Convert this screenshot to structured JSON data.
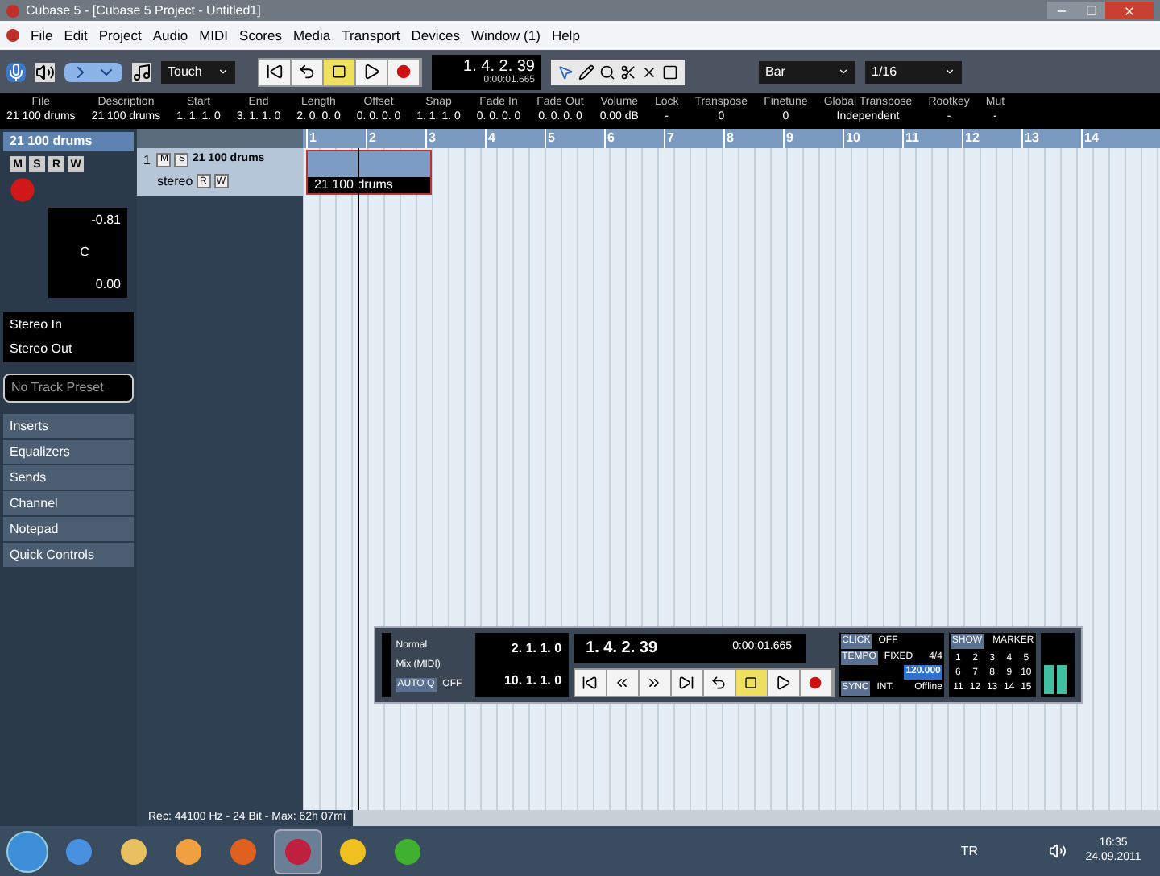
{
  "window": {
    "title": "Cubase 5 - [Cubase 5 Project - Untitled1]"
  },
  "menu": [
    "File",
    "Edit",
    "Project",
    "Audio",
    "MIDI",
    "Scores",
    "Media",
    "Transport",
    "Devices",
    "Window (1)",
    "Help"
  ],
  "toolbar": {
    "automation_mode": "Touch",
    "transport": [
      {
        "kind": "start",
        "active": false
      },
      {
        "kind": "cycle",
        "active": false
      },
      {
        "kind": "stop",
        "active": true
      },
      {
        "kind": "play",
        "active": false
      },
      {
        "kind": "record",
        "active": false
      }
    ],
    "position": "1. 4. 2. 39",
    "time": "0:00:01.665",
    "grid": "Bar",
    "quantize": "1/16"
  },
  "info_line": [
    {
      "label": "File",
      "value": "21 100 drums"
    },
    {
      "label": "Description",
      "value": "21 100 drums"
    },
    {
      "label": "Start",
      "value": "1. 1. 1. 0"
    },
    {
      "label": "End",
      "value": "3. 1. 1. 0"
    },
    {
      "label": "Length",
      "value": "2. 0. 0. 0"
    },
    {
      "label": "Offset",
      "value": "0. 0. 0. 0"
    },
    {
      "label": "Snap",
      "value": "1. 1. 1. 0"
    },
    {
      "label": "Fade In",
      "value": "0. 0. 0. 0"
    },
    {
      "label": "Fade Out",
      "value": "0. 0. 0. 0"
    },
    {
      "label": "Volume",
      "value": "0.00 dB"
    },
    {
      "label": "Lock",
      "value": "-"
    },
    {
      "label": "Transpose",
      "value": "0"
    },
    {
      "label": "Finetune",
      "value": "0"
    },
    {
      "label": "Global Transpose",
      "value": "Independent"
    },
    {
      "label": "Rootkey",
      "value": "-"
    },
    {
      "label": "Mut",
      "value": "-"
    }
  ],
  "inspector": {
    "track_name": "21 100 drums",
    "buttons": [
      "M",
      "S",
      "R",
      "W"
    ],
    "volume": "-0.81",
    "pan": "C",
    "delay": "0.00",
    "input": "Stereo In",
    "output": "Stereo Out",
    "preset": "No Track Preset",
    "sections": [
      "Inserts",
      "Equalizers",
      "Sends",
      "Channel",
      "Notepad",
      "Quick Controls"
    ]
  },
  "track": {
    "number": "1",
    "name": "21 100 drums",
    "channel": "stereo",
    "buttons": [
      "M",
      "S",
      "R",
      "W"
    ],
    "event": "21 100 drums"
  },
  "ruler": [
    "1",
    "2",
    "3",
    "4",
    "5",
    "6",
    "7",
    "8",
    "9",
    "10",
    "11",
    "12",
    "13",
    "14"
  ],
  "transport": {
    "mode": "Normal",
    "mix": "Mix (MIDI)",
    "auto_q": "AUTO Q",
    "auto_q_state": "OFF",
    "left_locator": "2. 1. 1. 0",
    "right_locator": "10. 1. 1. 0",
    "position": "1. 4. 2. 39",
    "time": "0:00:01.665",
    "buttons": [
      {
        "kind": "start",
        "active": false
      },
      {
        "kind": "rewind",
        "active": false
      },
      {
        "kind": "forward",
        "active": false
      },
      {
        "kind": "end",
        "active": false
      },
      {
        "kind": "cycle",
        "active": false
      },
      {
        "kind": "stop",
        "active": true
      },
      {
        "kind": "play",
        "active": false
      },
      {
        "kind": "record",
        "active": false
      }
    ],
    "click": "CLICK",
    "click_state": "OFF",
    "tempo": "TEMPO",
    "tempo_state": "FIXED",
    "signature": "4/4",
    "bpm": "120.000",
    "sync": "SYNC",
    "sync_state": "INT.",
    "sync_mode": "Offline",
    "show": "SHOW",
    "marker": "MARKER",
    "markers": [
      "1",
      "2",
      "3",
      "4",
      "5",
      "6",
      "7",
      "8",
      "9",
      "10",
      "11",
      "12",
      "13",
      "14",
      "15"
    ]
  },
  "status_bar": "Rec: 44100 Hz - 24 Bit - Max: 62h 07mi",
  "taskbar": {
    "apps": [
      {
        "kind": "browser",
        "selected": false
      },
      {
        "kind": "folder",
        "selected": false
      },
      {
        "kind": "media",
        "selected": false
      },
      {
        "kind": "fox",
        "selected": false
      },
      {
        "kind": "cubase",
        "selected": true
      },
      {
        "kind": "fruit",
        "selected": false
      },
      {
        "kind": "leaf",
        "selected": false
      }
    ],
    "language": "TR",
    "time": "16:35",
    "date": "24.09.2011"
  }
}
